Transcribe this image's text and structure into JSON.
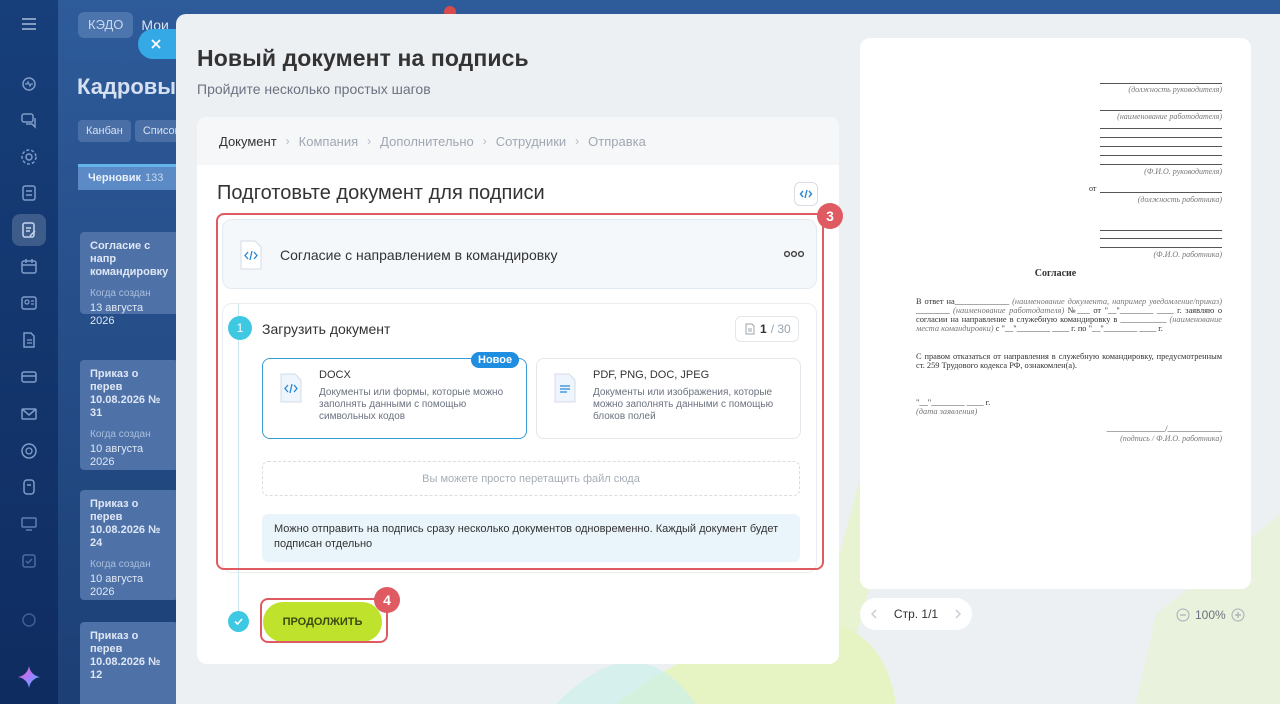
{
  "app_bg": {
    "tab_kedo": "КЭДО",
    "tab_mine": "Мои",
    "title": "Кадровые",
    "view_kanban": "Канбан",
    "view_list": "Список",
    "column_name": "Черновик",
    "column_count": "133",
    "cards": [
      {
        "title": "Согласие с напр командировку",
        "created_label": "Когда создан",
        "date": "13 августа 2026"
      },
      {
        "title": "Приказ о перев 10.08.2026 № 31",
        "created_label": "Когда создан",
        "date": "10 августа 2026"
      },
      {
        "title": "Приказ о перев 10.08.2026 № 24",
        "created_label": "Когда создан",
        "date": "10 августа 2026"
      },
      {
        "title": "Приказ о перев 10.08.2026 № 12",
        "created_label": "",
        "date": ""
      }
    ]
  },
  "slider": {
    "title": "Новый документ на подпись",
    "subtitle": "Пройдите несколько простых шагов"
  },
  "wizard": {
    "steps": [
      "Документ",
      "Компания",
      "Дополнительно",
      "Сотрудники",
      "Отправка"
    ],
    "active_step": 0,
    "heading": "Подготовьте документ для подписи",
    "document_name": "Согласие с направлением в командировку",
    "step_number": "1",
    "step_label": "Загрузить документ",
    "counter_current": "1",
    "counter_total": "/ 30",
    "options": [
      {
        "name": "DOCX",
        "description": "Документы или формы, которые можно заполнять данными с помощью символьных кодов",
        "badge": "Новое",
        "selected": true
      },
      {
        "name": "PDF, PNG, DOC, JPEG",
        "description": "Документы или изображения, которые можно заполнять данными с помощью блоков полей",
        "badge": "",
        "selected": false
      }
    ],
    "drop_hint": "Вы можете просто перетащить файл сюда",
    "info_text": "Можно отправить на подпись сразу несколько документов одновременно. Каждый документ будет подписан отдельно",
    "continue_label": "ПРОДОЛЖИТЬ",
    "callout_3": "3",
    "callout_4": "4"
  },
  "preview": {
    "cap_position_manager": "(должность руководителя)",
    "cap_employer_name": "(наименование работодателя)",
    "cap_manager_fio": "(Ф.И.О. руководителя)",
    "from_label": "от",
    "cap_employee_position": "(должность работника)",
    "cap_employee_fio": "(Ф.И.О. работника)",
    "heading": "Согласие",
    "para1_start": "В ответ на_____________ ",
    "para1_i1": "(наименование документа, например уведомление/приказ)",
    "para1_mid1": " ________ ",
    "para1_i2": "(наименование работодателя)",
    "para1_mid2": " №___ от \"__\"________ ____ г. заявляю о согласии на направление в служебную командировку в ___________ ",
    "para1_i3": "(наименование места командировки)",
    "para1_end": " с \"__\"________ ____ г. по \"__\"________ ____ г.",
    "para2": "С правом отказаться от направления в служебную командировку, предусмотренным ст. 259 Трудового кодекса РФ, ознакомлен(а).",
    "date_line": "\"__\"________ ____ г.",
    "cap_date": "(дата заявления)",
    "sign_line": "______________/_____________",
    "cap_signature": "(подпись / Ф.И.О. работника)",
    "page_label": "Стр. 1/1",
    "zoom_label": "100%"
  },
  "colors": {
    "accent_green": "#bfe32c",
    "accent_blue": "#3a9ad6",
    "callout_red": "#e05a62",
    "step_cyan": "#3fc8e2"
  }
}
